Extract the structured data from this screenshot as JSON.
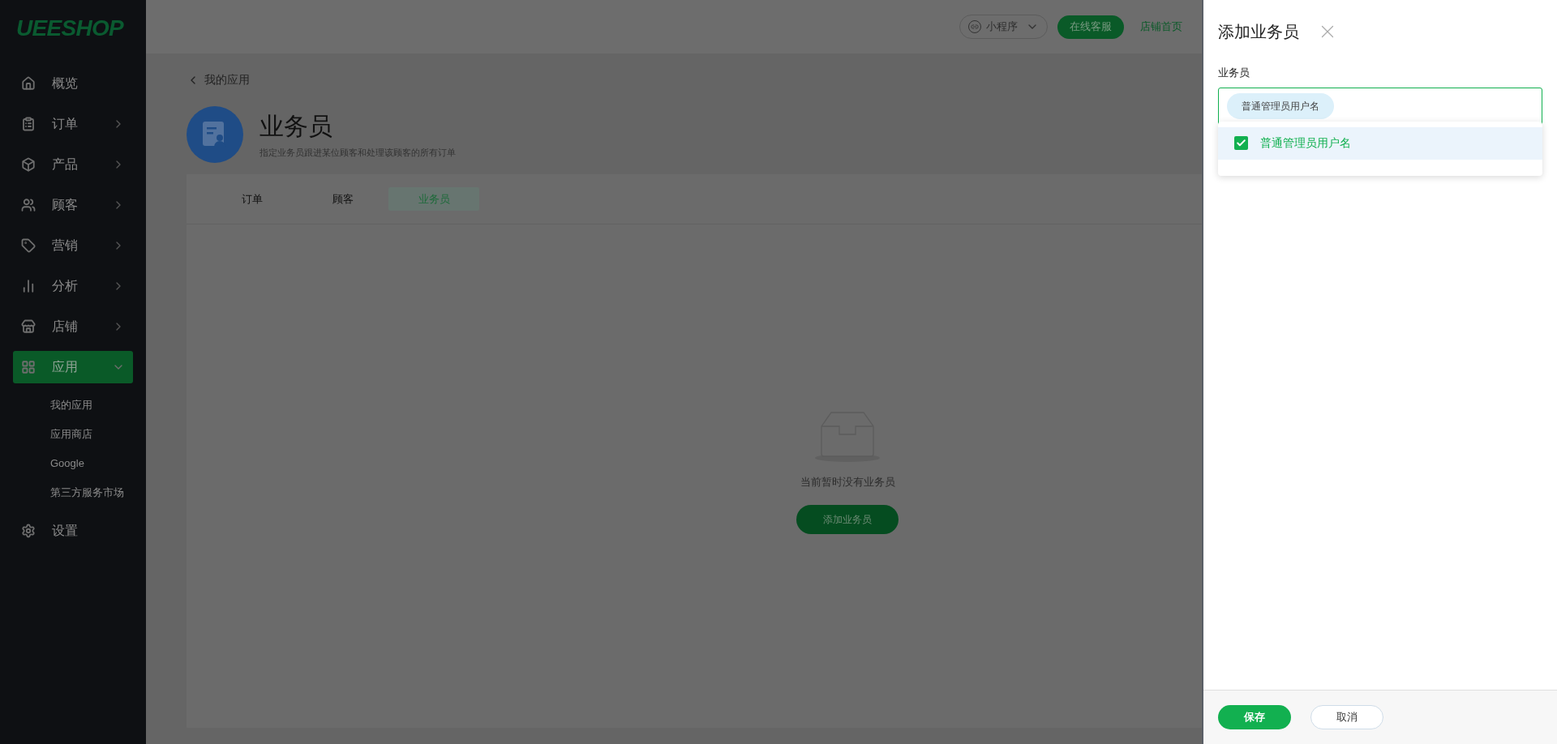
{
  "logo": "UEESHOP",
  "sidebar": {
    "items": [
      {
        "label": "概览",
        "selected": false
      },
      {
        "label": "订单",
        "selected": false,
        "expanded": false
      },
      {
        "label": "产品",
        "selected": false,
        "expanded": false
      },
      {
        "label": "顾客",
        "selected": false,
        "expanded": false
      },
      {
        "label": "营销",
        "selected": false,
        "expanded": false
      },
      {
        "label": "分析",
        "selected": false,
        "expanded": false
      },
      {
        "label": "店铺",
        "selected": false,
        "expanded": false
      },
      {
        "label": "应用",
        "selected": true,
        "expanded": true,
        "children": [
          {
            "label": "我的应用"
          },
          {
            "label": "应用商店"
          },
          {
            "label": "Google"
          },
          {
            "label": "第三方服务市场"
          }
        ]
      },
      {
        "label": "设置",
        "selected": false
      }
    ]
  },
  "header": {
    "mini_program": "小程序",
    "support_button": "在线客服",
    "store_link": "店铺首页"
  },
  "page": {
    "back_link": "我的应用",
    "title": "业务员",
    "subtitle": "指定业务员跟进某位顾客和处理该顾客的所有订单",
    "tabs": [
      {
        "label": "订单",
        "selected": false
      },
      {
        "label": "顾客",
        "selected": false
      },
      {
        "label": "业务员",
        "selected": true
      }
    ],
    "empty_text": "当前暂时没有业务员",
    "add_button": "添加业务员"
  },
  "drawer": {
    "title": "添加业务员",
    "field_label": "业务员",
    "chips": [
      "普通管理员用户名"
    ],
    "options": [
      {
        "label": "普通管理员用户名",
        "checked": true
      }
    ],
    "save_button": "保存",
    "cancel_button": "取消"
  }
}
